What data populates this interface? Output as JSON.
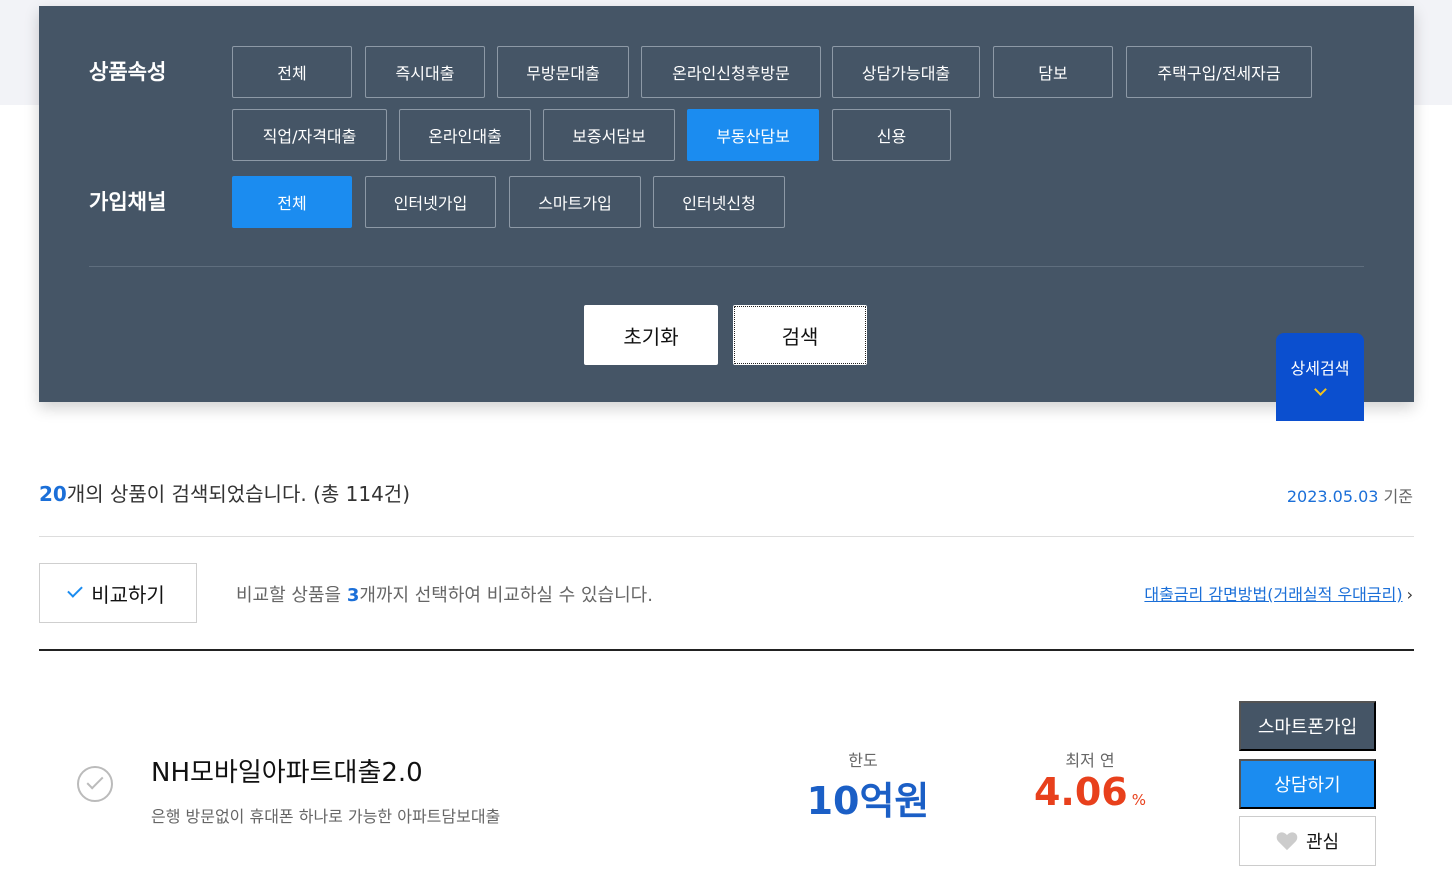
{
  "filters": {
    "attribute": {
      "label": "상품속성",
      "chips": [
        {
          "label": "전체",
          "active": false
        },
        {
          "label": "즉시대출",
          "active": false
        },
        {
          "label": "무방문대출",
          "active": false
        },
        {
          "label": "온라인신청후방문",
          "active": false
        },
        {
          "label": "상담가능대출",
          "active": false
        },
        {
          "label": "담보",
          "active": false
        },
        {
          "label": "주택구입/전세자금",
          "active": false
        },
        {
          "label": "직업/자격대출",
          "active": false
        },
        {
          "label": "온라인대출",
          "active": false
        },
        {
          "label": "보증서담보",
          "active": false
        },
        {
          "label": "부동산담보",
          "active": true
        },
        {
          "label": "신용",
          "active": false
        }
      ]
    },
    "channel": {
      "label": "가입채널",
      "chips": [
        {
          "label": "전체",
          "active": true
        },
        {
          "label": "인터넷가입",
          "active": false
        },
        {
          "label": "스마트가입",
          "active": false
        },
        {
          "label": "인터넷신청",
          "active": false
        }
      ]
    },
    "reset_label": "초기화",
    "search_label": "검색",
    "detail_search_label": "상세검색"
  },
  "results": {
    "count": "20",
    "count_suffix": "개의 상품이 검색되었습니다. (총 114건)",
    "as_of_date": "2023.05.03",
    "as_of_suffix": " 기준"
  },
  "compare": {
    "button_label": "비교하기",
    "note_prefix": "비교할 상품을 ",
    "note_count": "3",
    "note_suffix": "개까지 선택하여 비교하실 수 있습니다.",
    "rate_link": "대출금리 감면방법(거래실적 우대금리)",
    "rate_link_arrow": "›"
  },
  "product": {
    "name": "NH모바일아파트대출2.0",
    "description": "은행 방문없이 휴대폰 하나로 가능한 아파트담보대출",
    "limit_label": "한도",
    "limit_value": "10억원",
    "rate_label": "최저 연",
    "rate_value": "4.06",
    "rate_unit": "%",
    "buttons": {
      "smart": "스마트폰가입",
      "consult": "상담하기",
      "favorite": "관심"
    }
  },
  "colors": {
    "panel": "#455566",
    "accent": "#1b8cf0",
    "detail_tab": "#0b4fcf",
    "rate": "#e8401c",
    "limit": "#1b5fc6"
  }
}
